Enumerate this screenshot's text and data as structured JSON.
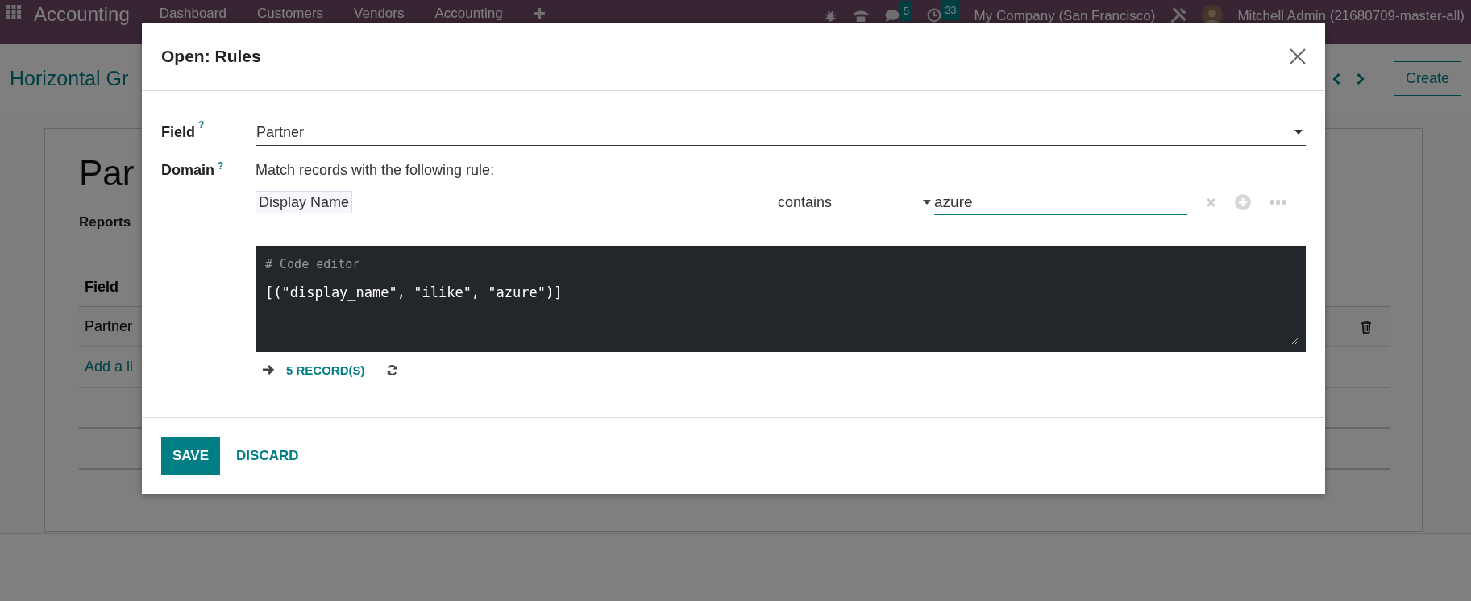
{
  "navbar": {
    "app_name": "Accounting",
    "menu": [
      "Dashboard",
      "Customers",
      "Vendors",
      "Accounting"
    ],
    "messages_count": "5",
    "activities_count": "33",
    "company": "My Company (San Francisco)",
    "user": "Mitchell Admin (21680709-master-all)"
  },
  "control_panel": {
    "breadcrumb": "Horizontal Gr",
    "create_button": "Create"
  },
  "sheet": {
    "title": "Par",
    "section": "Reports",
    "table": {
      "columns": [
        "Field"
      ],
      "rows": [
        {
          "cells": [
            "Partner"
          ]
        }
      ],
      "add_line": "Add a li"
    }
  },
  "dialog": {
    "title": "Open: Rules",
    "field": {
      "label": "Field",
      "help": "?",
      "value": "Partner"
    },
    "domain": {
      "label": "Domain",
      "help": "?",
      "intro": "Match records with the following rule:",
      "rule": {
        "field": "Display Name",
        "operator": "contains",
        "value": "azure"
      },
      "code_comment": "# Code editor",
      "code": "[(\"display_name\", \"ilike\", \"azure\")]",
      "record_count": "5 RECORD(S)"
    },
    "buttons": [
      {
        "label": "SAVE",
        "kind": "primary"
      },
      {
        "label": "DISCARD",
        "kind": "secondary"
      }
    ]
  }
}
